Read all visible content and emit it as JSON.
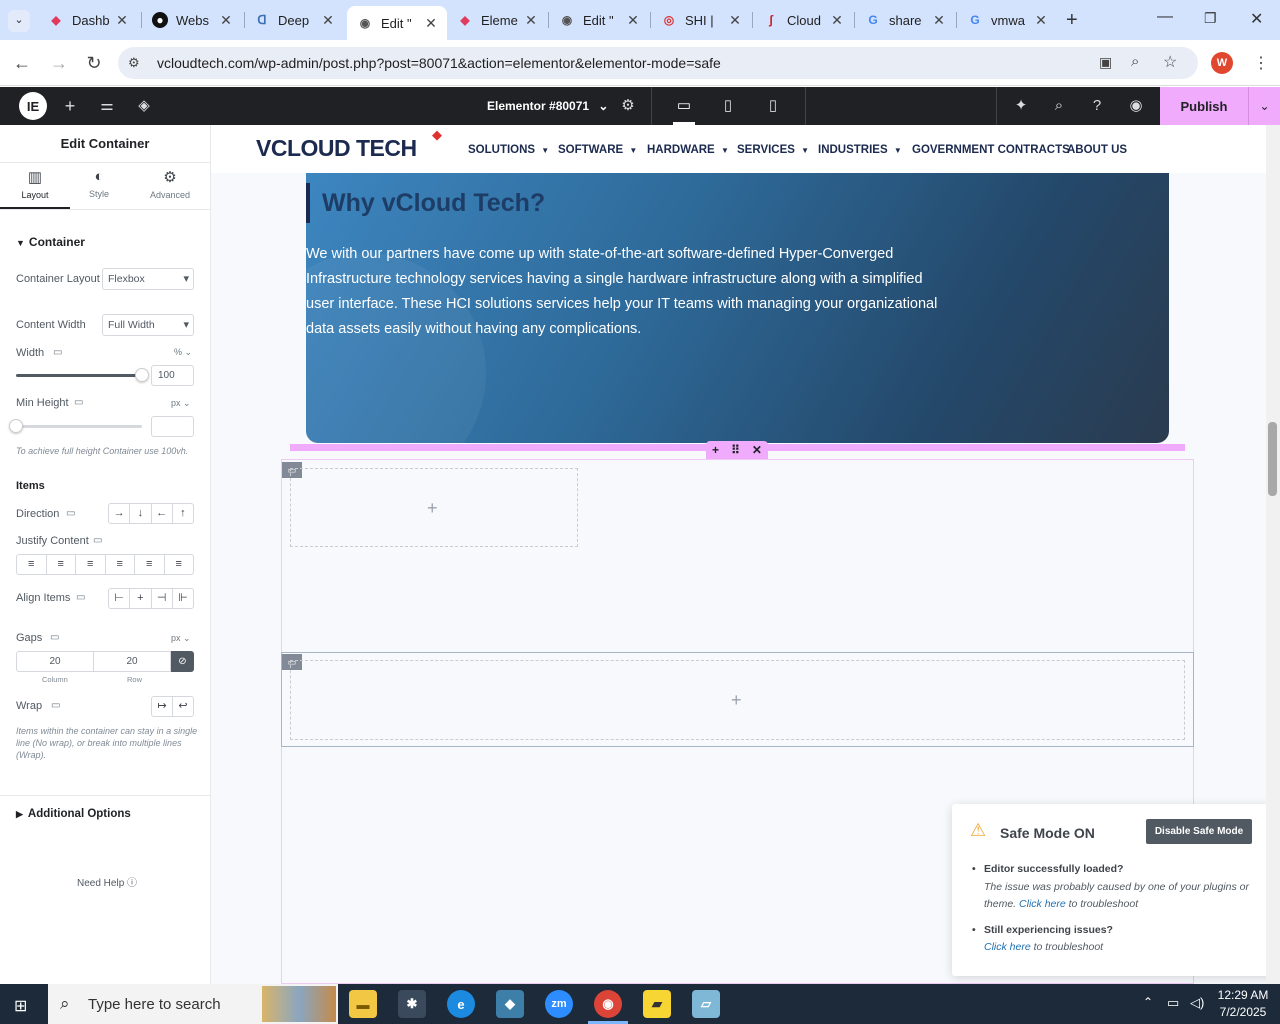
{
  "browser": {
    "tabs": [
      {
        "title": "Dashb",
        "icon": "elementor-icon"
      },
      {
        "title": "Webs",
        "icon": "github-icon"
      },
      {
        "title": "Deep",
        "icon": "deepl-icon"
      },
      {
        "title": "Edit \"",
        "icon": "globe-icon"
      },
      {
        "title": "Eleme",
        "icon": "elementor-icon"
      },
      {
        "title": "Edit \"",
        "icon": "globe-icon"
      },
      {
        "title": "SHI |",
        "icon": "shi-icon"
      },
      {
        "title": "Cloud",
        "icon": "cloud-icon"
      },
      {
        "title": "share",
        "icon": "google-icon"
      },
      {
        "title": "vmwa",
        "icon": "google-icon"
      }
    ],
    "url": "vcloudtech.com/wp-admin/post.php?post=80071&action=elementor&elementor-mode=safe",
    "profile_initial": "W"
  },
  "editor": {
    "document_title": "Elementor #80071",
    "publish_label": "Publish"
  },
  "panel": {
    "title": "Edit Container",
    "tabs": [
      "Layout",
      "Style",
      "Advanced"
    ],
    "section": "Container",
    "container_layout_label": "Container Layout",
    "container_layout_value": "Flexbox",
    "content_width_label": "Content Width",
    "content_width_value": "Full Width",
    "width_label": "Width",
    "width_unit": "%",
    "width_value": "100",
    "min_height_label": "Min Height",
    "min_height_unit": "px",
    "min_height_hint": "To achieve full height Container use 100vh.",
    "items_heading": "Items",
    "direction_label": "Direction",
    "justify_label": "Justify Content",
    "align_label": "Align Items",
    "gaps_label": "Gaps",
    "gaps_unit": "px",
    "gap_column": "20",
    "gap_row": "20",
    "gap_column_label": "Column",
    "gap_row_label": "Row",
    "wrap_label": "Wrap",
    "wrap_hint": "Items within the container can stay in a single line (No wrap), or break into multiple lines (Wrap).",
    "additional_options": "Additional Options",
    "need_help": "Need Help"
  },
  "site": {
    "logo_text": "VCLOUD TECH",
    "menu": [
      "SOLUTIONS",
      "SOFTWARE",
      "HARDWARE",
      "SERVICES",
      "INDUSTRIES",
      "GOVERNMENT CONTRACTS",
      "ABOUT US"
    ],
    "hero_title": "Why vCloud Tech?",
    "hero_text": "We with our partners have come up with state-of-the-art software-defined Hyper-Converged Infrastructure technology services having a single hardware infrastructure along with a simplified user interface. These HCI solutions services help your IT teams with managing your organizational data assets easily without having any complications."
  },
  "safe_mode": {
    "title": "Safe Mode ON",
    "disable_button": "Disable Safe Mode",
    "q1": "Editor successfully loaded?",
    "a1_text": "The issue was probably caused by one of your plugins or theme.",
    "a1_link": "Click here",
    "a1_suffix": "to troubleshoot",
    "q2": "Still experiencing issues?",
    "a2_link": "Click here",
    "a2_suffix": "to troubleshoot"
  },
  "taskbar": {
    "search_placeholder": "Type here to search",
    "time": "12:29 AM",
    "date": "7/2/2025"
  }
}
